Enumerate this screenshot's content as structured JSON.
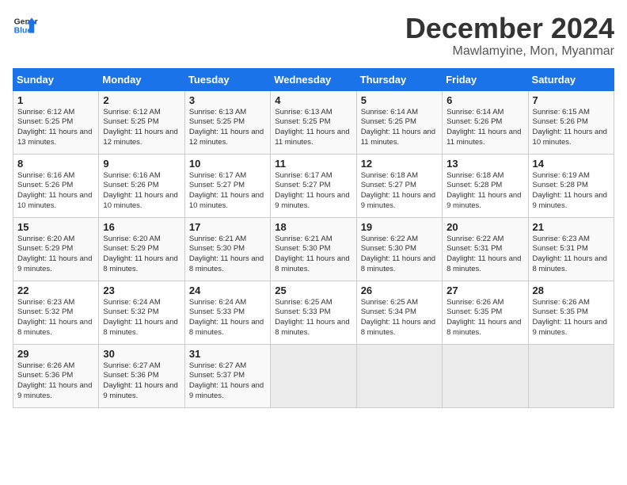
{
  "header": {
    "logo_line1": "General",
    "logo_line2": "Blue",
    "month": "December 2024",
    "location": "Mawlamyine, Mon, Myanmar"
  },
  "days_of_week": [
    "Sunday",
    "Monday",
    "Tuesday",
    "Wednesday",
    "Thursday",
    "Friday",
    "Saturday"
  ],
  "weeks": [
    [
      {
        "day": 1,
        "sunrise": "6:12 AM",
        "sunset": "5:25 PM",
        "daylight": "11 hours and 13 minutes."
      },
      {
        "day": 2,
        "sunrise": "6:12 AM",
        "sunset": "5:25 PM",
        "daylight": "11 hours and 12 minutes."
      },
      {
        "day": 3,
        "sunrise": "6:13 AM",
        "sunset": "5:25 PM",
        "daylight": "11 hours and 12 minutes."
      },
      {
        "day": 4,
        "sunrise": "6:13 AM",
        "sunset": "5:25 PM",
        "daylight": "11 hours and 11 minutes."
      },
      {
        "day": 5,
        "sunrise": "6:14 AM",
        "sunset": "5:25 PM",
        "daylight": "11 hours and 11 minutes."
      },
      {
        "day": 6,
        "sunrise": "6:14 AM",
        "sunset": "5:26 PM",
        "daylight": "11 hours and 11 minutes."
      },
      {
        "day": 7,
        "sunrise": "6:15 AM",
        "sunset": "5:26 PM",
        "daylight": "11 hours and 10 minutes."
      }
    ],
    [
      {
        "day": 8,
        "sunrise": "6:16 AM",
        "sunset": "5:26 PM",
        "daylight": "11 hours and 10 minutes."
      },
      {
        "day": 9,
        "sunrise": "6:16 AM",
        "sunset": "5:26 PM",
        "daylight": "11 hours and 10 minutes."
      },
      {
        "day": 10,
        "sunrise": "6:17 AM",
        "sunset": "5:27 PM",
        "daylight": "11 hours and 10 minutes."
      },
      {
        "day": 11,
        "sunrise": "6:17 AM",
        "sunset": "5:27 PM",
        "daylight": "11 hours and 9 minutes."
      },
      {
        "day": 12,
        "sunrise": "6:18 AM",
        "sunset": "5:27 PM",
        "daylight": "11 hours and 9 minutes."
      },
      {
        "day": 13,
        "sunrise": "6:18 AM",
        "sunset": "5:28 PM",
        "daylight": "11 hours and 9 minutes."
      },
      {
        "day": 14,
        "sunrise": "6:19 AM",
        "sunset": "5:28 PM",
        "daylight": "11 hours and 9 minutes."
      }
    ],
    [
      {
        "day": 15,
        "sunrise": "6:20 AM",
        "sunset": "5:29 PM",
        "daylight": "11 hours and 9 minutes."
      },
      {
        "day": 16,
        "sunrise": "6:20 AM",
        "sunset": "5:29 PM",
        "daylight": "11 hours and 8 minutes."
      },
      {
        "day": 17,
        "sunrise": "6:21 AM",
        "sunset": "5:30 PM",
        "daylight": "11 hours and 8 minutes."
      },
      {
        "day": 18,
        "sunrise": "6:21 AM",
        "sunset": "5:30 PM",
        "daylight": "11 hours and 8 minutes."
      },
      {
        "day": 19,
        "sunrise": "6:22 AM",
        "sunset": "5:30 PM",
        "daylight": "11 hours and 8 minutes."
      },
      {
        "day": 20,
        "sunrise": "6:22 AM",
        "sunset": "5:31 PM",
        "daylight": "11 hours and 8 minutes."
      },
      {
        "day": 21,
        "sunrise": "6:23 AM",
        "sunset": "5:31 PM",
        "daylight": "11 hours and 8 minutes."
      }
    ],
    [
      {
        "day": 22,
        "sunrise": "6:23 AM",
        "sunset": "5:32 PM",
        "daylight": "11 hours and 8 minutes."
      },
      {
        "day": 23,
        "sunrise": "6:24 AM",
        "sunset": "5:32 PM",
        "daylight": "11 hours and 8 minutes."
      },
      {
        "day": 24,
        "sunrise": "6:24 AM",
        "sunset": "5:33 PM",
        "daylight": "11 hours and 8 minutes."
      },
      {
        "day": 25,
        "sunrise": "6:25 AM",
        "sunset": "5:33 PM",
        "daylight": "11 hours and 8 minutes."
      },
      {
        "day": 26,
        "sunrise": "6:25 AM",
        "sunset": "5:34 PM",
        "daylight": "11 hours and 8 minutes."
      },
      {
        "day": 27,
        "sunrise": "6:26 AM",
        "sunset": "5:35 PM",
        "daylight": "11 hours and 8 minutes."
      },
      {
        "day": 28,
        "sunrise": "6:26 AM",
        "sunset": "5:35 PM",
        "daylight": "11 hours and 9 minutes."
      }
    ],
    [
      {
        "day": 29,
        "sunrise": "6:26 AM",
        "sunset": "5:36 PM",
        "daylight": "11 hours and 9 minutes."
      },
      {
        "day": 30,
        "sunrise": "6:27 AM",
        "sunset": "5:36 PM",
        "daylight": "11 hours and 9 minutes."
      },
      {
        "day": 31,
        "sunrise": "6:27 AM",
        "sunset": "5:37 PM",
        "daylight": "11 hours and 9 minutes."
      },
      null,
      null,
      null,
      null
    ]
  ]
}
